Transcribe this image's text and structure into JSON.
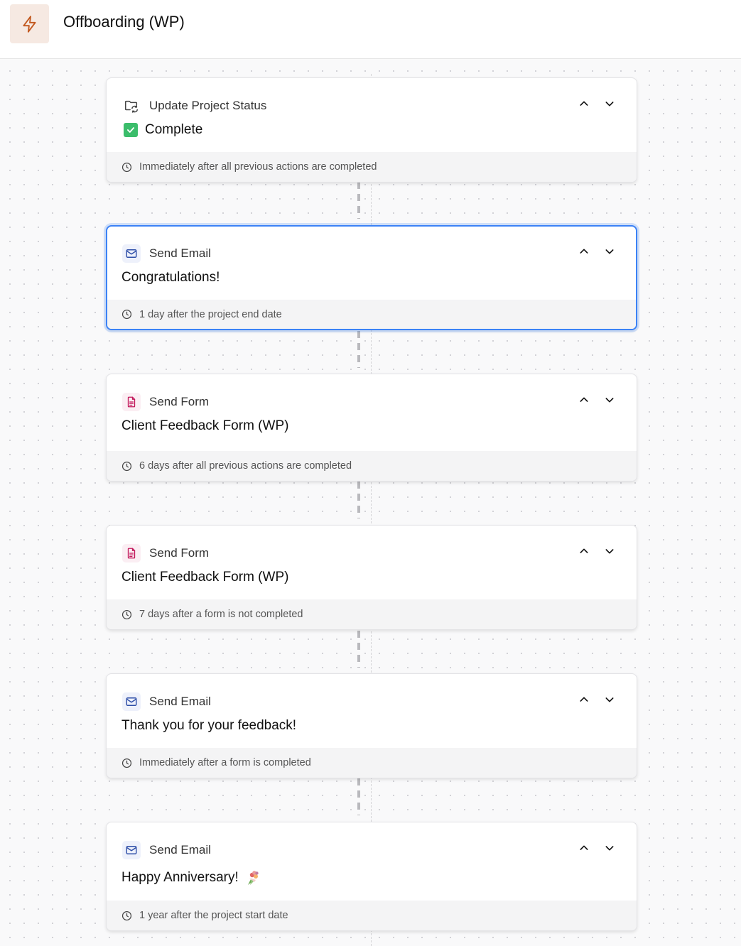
{
  "header": {
    "title": "Offboarding (WP)",
    "icon": "lightning-icon",
    "icon_color": "#c2571d"
  },
  "steps": [
    {
      "type_label": "Update Project Status",
      "type_icon": "folder-sync-icon",
      "title": "Complete",
      "title_icon": "check-box-icon",
      "timing": "Immediately after all previous actions are completed"
    },
    {
      "type_label": "Send Email",
      "type_icon": "mail-icon",
      "title": "Congratulations!",
      "timing": "1 day after the project end date",
      "selected": true
    },
    {
      "type_label": "Send Form",
      "type_icon": "form-document-icon",
      "title": "Client Feedback Form (WP)",
      "timing": "6 days after all previous actions are completed"
    },
    {
      "type_label": "Send Form",
      "type_icon": "form-document-icon",
      "title": "Client Feedback Form (WP)",
      "timing": "7 days after a form is not completed"
    },
    {
      "type_label": "Send Email",
      "type_icon": "mail-icon",
      "title": "Thank you for your feedback!",
      "timing": "Immediately after a form is completed"
    },
    {
      "type_label": "Send Email",
      "type_icon": "mail-icon",
      "title": "Happy Anniversary!",
      "title_emoji": "bouquet-icon",
      "timing": "1 year after the project start date"
    }
  ],
  "colors": {
    "accent_blue": "#3b82f6",
    "email_icon": "#2f4fa8",
    "form_icon": "#c2185b",
    "check_green": "#3bbd6b"
  }
}
